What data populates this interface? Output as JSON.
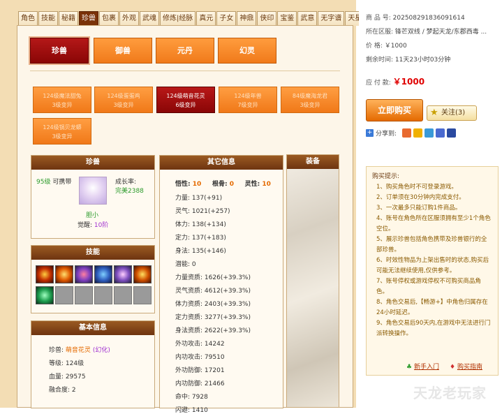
{
  "tabs": [
    "角色",
    "技能",
    "秘籍",
    "珍兽",
    "包裹",
    "外观",
    "武魂",
    "修炼|经脉",
    "真元",
    "子女",
    "神鼎",
    "侠印",
    "宝鉴",
    "武意",
    "无字谱",
    "天星盘"
  ],
  "active_tab": "珍兽",
  "main_buttons": [
    "珍兽",
    "御兽",
    "元丹",
    "幻灵"
  ],
  "pets": [
    {
      "level": "124级魔法甜兔",
      "sub": "3级变异"
    },
    {
      "level": "124级蛋蛋鸡",
      "sub": "3级变异"
    },
    {
      "level": "124级萌音花灵",
      "sub": "6级变异"
    },
    {
      "level": "124级年兽",
      "sub": "7级变异"
    },
    {
      "level": "84级魔海龙君",
      "sub": "3级变异"
    },
    {
      "level": "124级锅贝龙蟒",
      "sub": "3级变异"
    }
  ],
  "pet_box": {
    "header": "珍兽",
    "level": "95级",
    "carry": "可携带",
    "growth_label": "成长率:",
    "growth_value": "完美2388",
    "temper": "胆小",
    "awaken_label": "觉醒:",
    "awaken_value": "10阶"
  },
  "skills_box": {
    "header": "技能"
  },
  "basic_box": {
    "header": "基本信息",
    "name_label": "珍兽:",
    "name": "萌音花灵",
    "variant": "(幻化)",
    "level_label": "等级:",
    "level": "124级",
    "hp_label": "血量:",
    "hp": "29575",
    "fusion_label": "融合度:",
    "fusion": "2"
  },
  "other_box": {
    "header": "其它信息",
    "top": [
      {
        "k": "悟性:",
        "v": "10"
      },
      {
        "k": "根骨:",
        "v": "0"
      },
      {
        "k": "灵性:",
        "v": "10"
      }
    ],
    "stats": [
      {
        "k": "力量:",
        "v": "137(+91)"
      },
      {
        "k": "灵气:",
        "v": "1021(+257)"
      },
      {
        "k": "体力:",
        "v": "138(+134)"
      },
      {
        "k": "定力:",
        "v": "137(+183)"
      },
      {
        "k": "身法:",
        "v": "135(+146)"
      },
      {
        "k": "潜能:",
        "v": "0"
      },
      {
        "k": "力量资质:",
        "v": "1626(+39.3%)"
      },
      {
        "k": "灵气资质:",
        "v": "4612(+39.3%)"
      },
      {
        "k": "体力资质:",
        "v": "2403(+39.3%)"
      },
      {
        "k": "定力资质:",
        "v": "3277(+39.3%)"
      },
      {
        "k": "身法资质:",
        "v": "2622(+39.3%)"
      },
      {
        "k": "外功攻击:",
        "v": "14242"
      },
      {
        "k": "内功攻击:",
        "v": "79510"
      },
      {
        "k": "外功防御:",
        "v": "17201"
      },
      {
        "k": "内功防御:",
        "v": "21466"
      },
      {
        "k": "命中:",
        "v": "7928"
      },
      {
        "k": "闪避:",
        "v": "1410"
      }
    ]
  },
  "equip_box": {
    "header": "装备"
  },
  "right": {
    "sku_label": "商 品 号:",
    "sku": "202508291836091614",
    "server_label": "所在区服:",
    "server": "锋芒双线 / 梦起天龙/东郡西毒 ...",
    "price_label": "价      格:",
    "price": "￥1000",
    "remain_label": "剩余时间:",
    "remain": "11天23小时03分钟",
    "pay_label": "应 付 款:",
    "pay": "￥1000",
    "buy": "立即购买",
    "fav": "关注(3)",
    "share": "分享到:"
  },
  "tips": {
    "title": "购买提示:",
    "items": [
      "1、购买角色时不可登录游戏。",
      "2、订单须在30分钟内完成支付。",
      "3、一次最多只能订购1件商品。",
      "4、账号在角色所在区服须拥有至少1个角色空位。",
      "5、展示珍兽包括角色携带及珍兽银行的全部珍兽。",
      "6、时效性物品为上架出售时的状态,购买后可能无法继续使用,仅供参考。",
      "7、账号停权或游戏停权不可购买商品角色。",
      "8、角色交易后,【畅游+】中角色归属存在24小时延迟。",
      "9、角色交易后90天内,在游戏中无法进行门派转换操作。"
    ],
    "links": [
      "新手入门",
      "购买指南"
    ]
  },
  "watermark": "天龙老玩家",
  "colors": {
    "accent": "#f07a1a",
    "active": "#8a0606",
    "price": "#e00000"
  }
}
